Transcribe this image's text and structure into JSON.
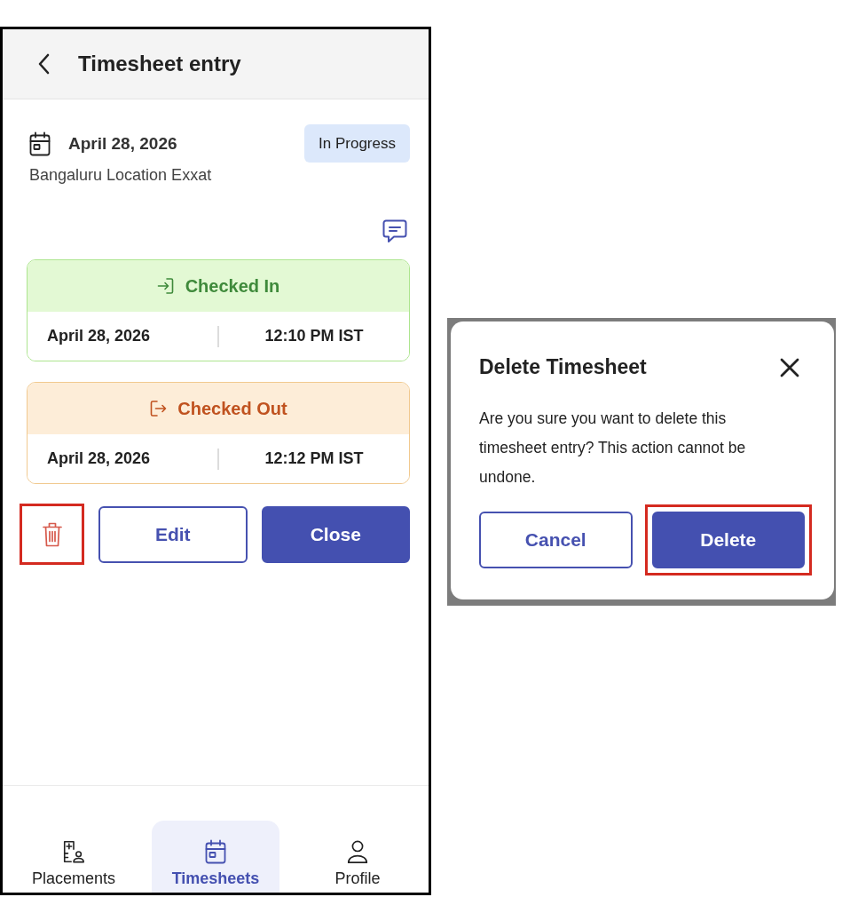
{
  "phone": {
    "header": {
      "title": "Timesheet entry"
    },
    "entry": {
      "date": "April 28, 2026",
      "status": "In Progress",
      "location": "Bangaluru Location Exxat"
    },
    "cards": [
      {
        "kind": "check_in",
        "title": "Checked In",
        "date": "April 28, 2026",
        "time": "12:10 PM IST"
      },
      {
        "kind": "check_out",
        "title": "Checked Out",
        "date": "April 28, 2026",
        "time": "12:12 PM IST"
      }
    ],
    "actions": [
      {
        "kind": "delete",
        "highlighted": true
      },
      {
        "kind": "outline",
        "label": "Edit",
        "highlighted": false
      },
      {
        "kind": "primary",
        "label": "Close",
        "highlighted": false
      }
    ],
    "nav": [
      {
        "kind": "placements",
        "label": "Placements",
        "selected": false
      },
      {
        "kind": "timesheets",
        "label": "Timesheets",
        "selected": true
      },
      {
        "kind": "profile",
        "label": "Profile",
        "selected": false
      }
    ]
  },
  "dialog": {
    "title": "Delete Timesheet",
    "message": "Are you sure you want to delete this timesheet entry? This action cannot be undone.",
    "buttons": [
      {
        "kind": "outline",
        "label": "Cancel",
        "highlighted": false
      },
      {
        "kind": "primary",
        "label": "Delete",
        "highlighted": true
      }
    ]
  }
}
